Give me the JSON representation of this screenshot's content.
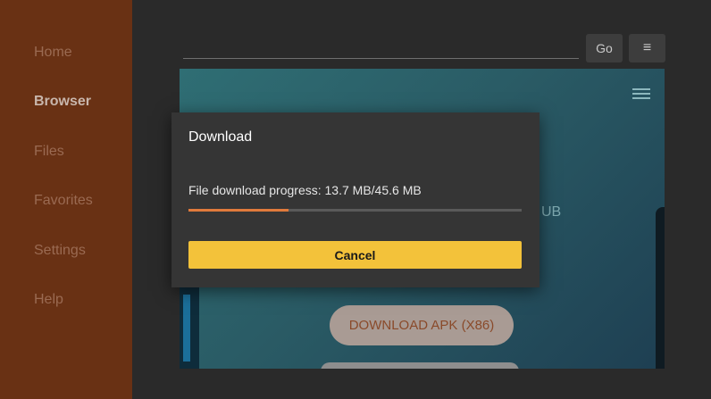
{
  "sidebar": {
    "items": [
      {
        "label": "Home",
        "active": false
      },
      {
        "label": "Browser",
        "active": true
      },
      {
        "label": "Files",
        "active": false
      },
      {
        "label": "Favorites",
        "active": false
      },
      {
        "label": "Settings",
        "active": false
      },
      {
        "label": "Help",
        "active": false
      }
    ]
  },
  "toolbar": {
    "go_label": "Go",
    "menu_icon": "≡"
  },
  "webpage": {
    "snippet_text": "UB",
    "download_button_label": "DOWNLOAD APK (X86)"
  },
  "dialog": {
    "title": "Download",
    "progress_text": "File download progress: 13.7 MB/45.6 MB",
    "progress_fraction": 0.3,
    "cancel_label": "Cancel"
  },
  "colors": {
    "sidebar_bg": "#693114",
    "accent_progress": "#e07a3c",
    "cancel_button": "#f3c23a"
  }
}
